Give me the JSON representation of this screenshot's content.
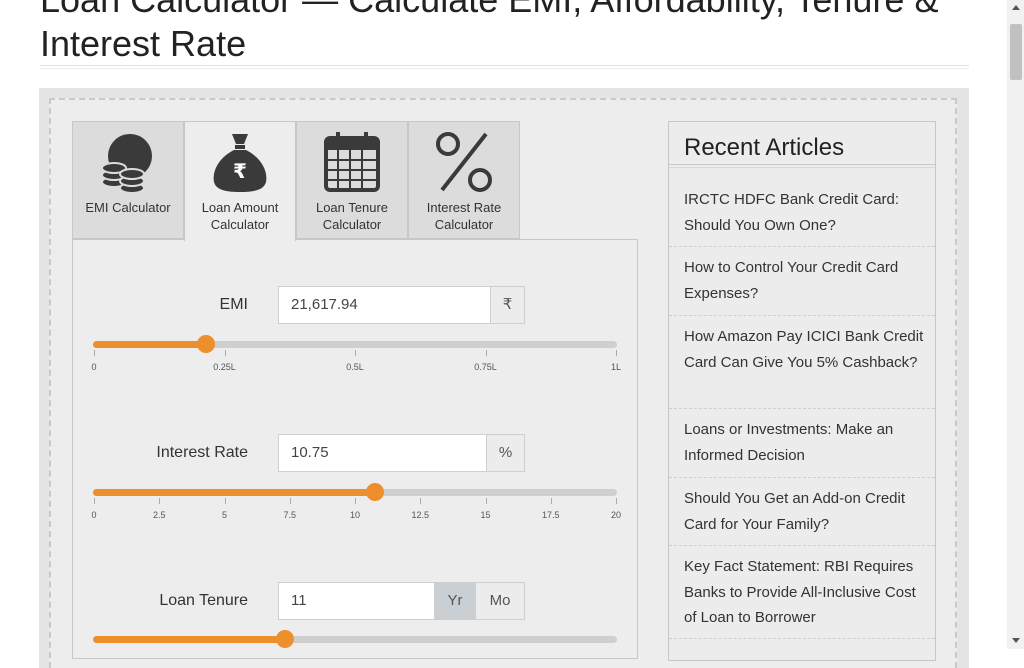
{
  "page": {
    "title": "Loan Calculator — Calculate EMI, Affordability, Tenure & Interest Rate"
  },
  "tabs": [
    {
      "label": "EMI Calculator",
      "icon": "coins-icon",
      "active": false
    },
    {
      "label": "Loan Amount Calculator",
      "icon": "money-bag-icon",
      "active": true
    },
    {
      "label": "Loan Tenure Calculator",
      "icon": "calendar-icon",
      "active": false
    },
    {
      "label": "Interest Rate Calculator",
      "icon": "percent-icon",
      "active": false
    }
  ],
  "form": {
    "emi": {
      "label": "EMI",
      "value": "21,617.94",
      "unit": "₹",
      "slider": {
        "min": 0,
        "max": 100000,
        "value": 21617.94,
        "ticks": [
          "0",
          "0.25L",
          "0.5L",
          "0.75L",
          "1L"
        ]
      }
    },
    "interest_rate": {
      "label": "Interest Rate",
      "value": "10.75",
      "unit": "%",
      "slider": {
        "min": 0,
        "max": 20,
        "value": 10.75,
        "ticks": [
          "0",
          "2.5",
          "5",
          "7.5",
          "10",
          "12.5",
          "15",
          "17.5",
          "20"
        ]
      }
    },
    "loan_tenure": {
      "label": "Loan Tenure",
      "value": "11",
      "unit_year": "Yr",
      "unit_month": "Mo",
      "selected_unit": "Yr",
      "slider": {
        "min": 0,
        "max": 30,
        "value": 11
      }
    }
  },
  "sidebar": {
    "title": "Recent Articles",
    "articles": [
      "IRCTC HDFC Bank Credit Card: Should You Own One?",
      "How to Control Your Credit Card Expenses?",
      "How Amazon Pay ICICI Bank Credit Card Can Give You 5% Cashback?",
      "Loans or Investments: Make an Informed Decision",
      "Should You Get an Add-on Credit Card for Your Family?",
      "Key Fact Statement: RBI Requires Banks to Provide All-Inclusive Cost of Loan to Borrower"
    ]
  },
  "colors": {
    "accent": "#ee8f2d",
    "track": "#cfcfcf",
    "icon_dark": "#3a3a3a"
  }
}
